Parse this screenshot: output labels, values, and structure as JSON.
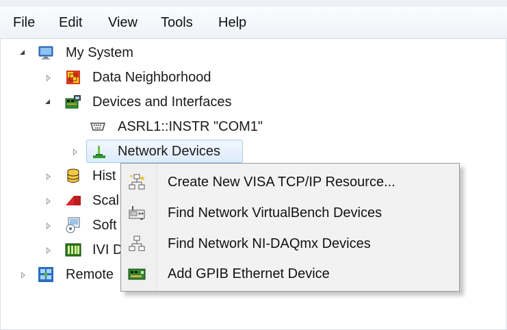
{
  "menubar": {
    "items": [
      {
        "label": "File"
      },
      {
        "label": "Edit"
      },
      {
        "label": "View"
      },
      {
        "label": "Tools"
      },
      {
        "label": "Help"
      }
    ]
  },
  "tree": {
    "my_system": "My System",
    "data_neighborhood": "Data Neighborhood",
    "devices_and_interfaces": "Devices and Interfaces",
    "asrl1": "ASRL1::INSTR \"COM1\"",
    "network_devices": "Network Devices",
    "historical_partial": "Hist",
    "scales_partial": "Scal",
    "software_partial": "Soft",
    "ivi_partial": "IVI D",
    "remote_partial": "Remote"
  },
  "context_menu": {
    "items": [
      {
        "label": "Create New VISA TCP/IP Resource...",
        "icon": "tcpip-resource-icon"
      },
      {
        "label": "Find Network VirtualBench Devices",
        "icon": "virtualbench-icon"
      },
      {
        "label": "Find Network NI-DAQmx Devices",
        "icon": "network-daqmx-icon"
      },
      {
        "label": "Add GPIB Ethernet Device",
        "icon": "gpib-ethernet-icon"
      }
    ]
  },
  "colors": {
    "selection_fill": "#dcebfb",
    "selection_border": "#a5c8ee",
    "menu_border": "#979797"
  }
}
